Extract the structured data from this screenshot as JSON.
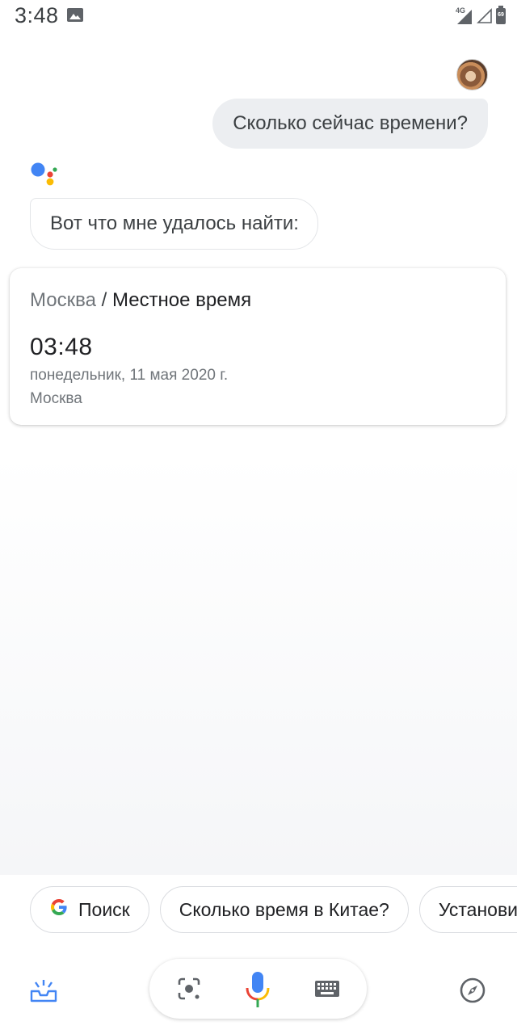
{
  "status_bar": {
    "time": "3:48",
    "network": "4G",
    "battery": "69"
  },
  "conversation": {
    "user_query": "Сколько сейчас времени?",
    "assistant_reply": "Вот что мне удалось найти:"
  },
  "time_card": {
    "city": "Москва",
    "separator": " / ",
    "title": "Местное время",
    "time": "03:48",
    "date": "понедельник, 11 мая 2020 г.",
    "location": "Москва"
  },
  "suggestions": [
    {
      "label": "Поиск",
      "icon": "google-g-icon"
    },
    {
      "label": "Сколько время в Китае?"
    },
    {
      "label": "Установить будильник"
    }
  ],
  "bottom_bar": {
    "left_icon": "updates-tray-icon",
    "lens_icon": "google-lens-icon",
    "mic_icon": "microphone-icon",
    "keyboard_icon": "keyboard-icon",
    "right_icon": "explore-compass-icon"
  },
  "colors": {
    "google_blue": "#4285F4",
    "google_red": "#EA4335",
    "google_yellow": "#FBBC04",
    "google_green": "#34A853",
    "icon_gray": "#5f6368"
  }
}
